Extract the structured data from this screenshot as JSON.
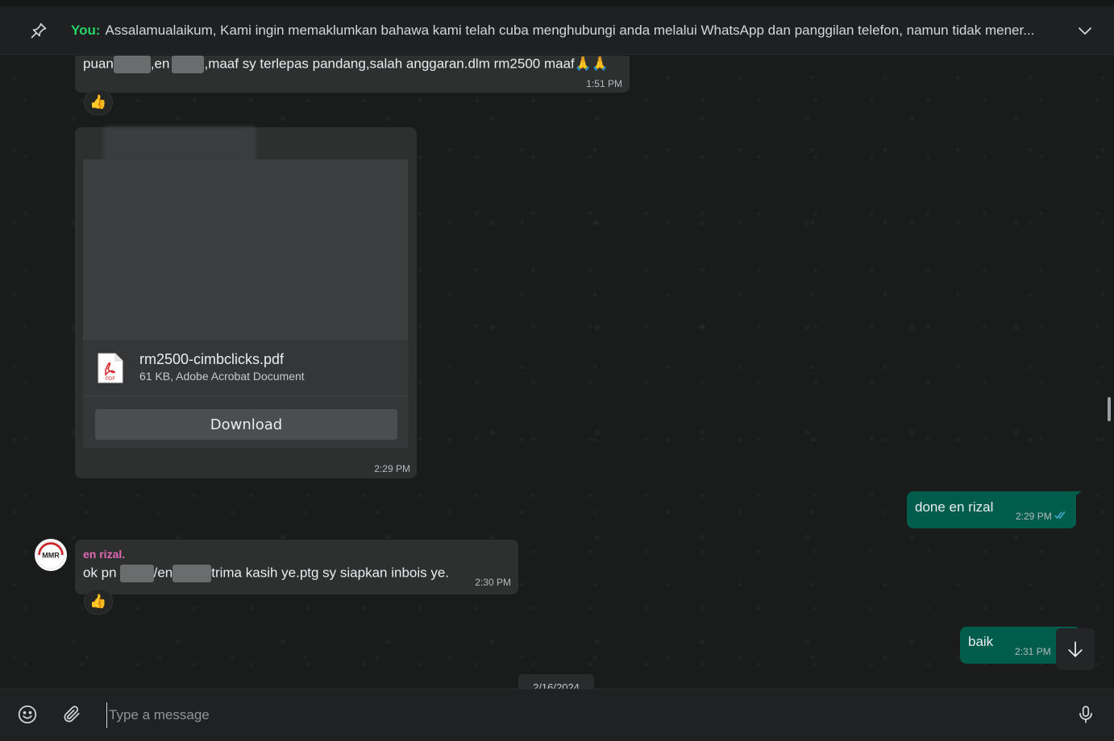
{
  "pinned": {
    "sender": "You:",
    "text": "Assalamualaikum,  Kami ingin memaklumkan bahawa kami telah cuba menghubungi anda melalui WhatsApp dan panggilan telefon, namun tidak mener..."
  },
  "messages": {
    "m1": {
      "part1": "puan",
      "part2": ",en",
      "part3": ",maaf sy terlepas pandang,salah anggaran.dlm rm2500 maaf🙏🙏",
      "time": "1:51 PM",
      "reaction": "👍"
    },
    "doc": {
      "file_name": "rm2500-cimbclicks.pdf",
      "file_meta": "61 KB, Adobe Acrobat Document",
      "pdf_label": "PDF",
      "download_label": "Download",
      "time": "2:29 PM"
    },
    "out1": {
      "text": "done en rizal",
      "time": "2:29 PM"
    },
    "in2": {
      "sender": "en rizal.",
      "avatar_text": "MMR",
      "part1": "ok pn",
      "part2": "/en",
      "part3": "trima kasih ye.ptg sy siapkan inbois ye.",
      "time": "2:30 PM",
      "reaction": "👍"
    },
    "out2": {
      "text": "baik",
      "time": "2:31 PM"
    }
  },
  "date_chip": "2/16/2024",
  "composer": {
    "placeholder": "Type a message"
  },
  "icons": {
    "pin": "pin-icon",
    "chevron": "chevron-down-icon",
    "emoji": "emoji-icon",
    "attach": "paperclip-icon",
    "mic": "microphone-icon",
    "scroll": "arrow-down-icon"
  },
  "colors": {
    "accent_green": "#25d366",
    "outgoing_bubble": "#005c4b",
    "incoming_bubble": "#2e2f2f",
    "sender_pink": "#e26ab6",
    "read_ticks": "#53bdeb"
  }
}
